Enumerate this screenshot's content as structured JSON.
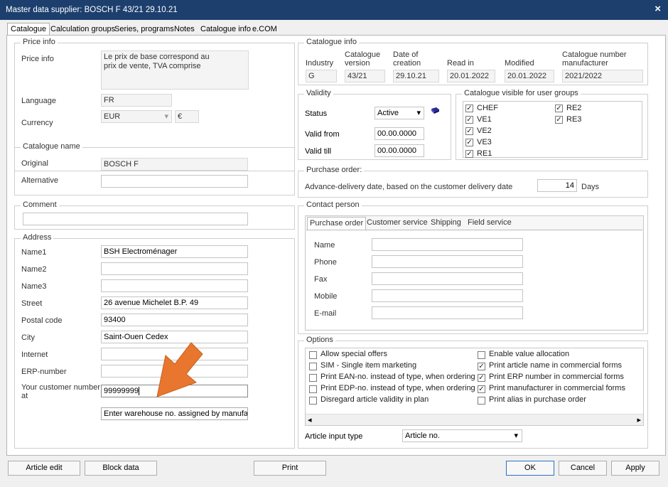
{
  "window": {
    "title": "Master data supplier: BOSCH F  43/21     29.10.21",
    "close": "×"
  },
  "tabs": [
    "Catalogue",
    "Calculation groups",
    "Series, programs",
    "Notes",
    "Catalogue info",
    "e.COM"
  ],
  "price_info": {
    "group": "Price info",
    "label": "Price info",
    "text_line1": "Le prix de base correspond au",
    "text_line2": "prix de vente, TVA comprise",
    "language_label": "Language",
    "language": "FR",
    "currency_label": "Currency",
    "currency": "EUR",
    "currency_symbol": "€",
    "dropdown_arrow": "▾"
  },
  "catalogue_name": {
    "group": "Catalogue name",
    "original_label": "Original",
    "original": "BOSCH F",
    "alternative_label": "Alternative",
    "alternative": ""
  },
  "comment": {
    "group": "Comment",
    "value": ""
  },
  "address": {
    "group": "Address",
    "name1_label": "Name1",
    "name1": "BSH Electroménager",
    "name2_label": "Name2",
    "name2": "",
    "name3_label": "Name3",
    "name3": "",
    "street_label": "Street",
    "street": "26 avenue Michelet B.P. 49",
    "postal_label": "Postal code",
    "postal": "93400",
    "city_label": "City",
    "city": "Saint-Ouen Cedex",
    "internet_label": "Internet",
    "internet": "",
    "erp_label": "ERP-number",
    "erp": "",
    "customer_label_line1": "Your customer number",
    "customer_label_line2": "at",
    "customer_number": "99999999",
    "warehouse": "Enter warehouse no. assigned by manufacturer"
  },
  "catalogue_info": {
    "group": "Catalogue info",
    "industry_label": "Industry",
    "industry": "G",
    "version_label1": "Catalogue",
    "version_label2": "version",
    "version": "43/21",
    "date_label1": "Date of",
    "date_label2": "creation",
    "date": "29.10.21",
    "read_label": "Read in",
    "read": "20.01.2022",
    "modified_label": "Modified",
    "modified": "20.01.2022",
    "mfr_label1": "Catalogue number",
    "mfr_label2": "manufacturer",
    "mfr": "2021/2022"
  },
  "validity": {
    "group": "Validity",
    "status_label": "Status",
    "status": "Active",
    "from_label": "Valid from",
    "from": "00.00.0000",
    "till_label": "Valid till",
    "till": "00.00.0000",
    "dropdown_arrow": "▾"
  },
  "user_groups": {
    "group": "Catalogue visible for user groups",
    "check": "✓",
    "items": [
      {
        "label": "CHEF"
      },
      {
        "label": "VE1"
      },
      {
        "label": "VE2"
      },
      {
        "label": "VE3"
      },
      {
        "label": "RE1"
      },
      {
        "label": "RE2"
      },
      {
        "label": "RE3"
      }
    ]
  },
  "purchase_order": {
    "group": "Purchase order:",
    "advance_label": "Advance-delivery date, based on the customer delivery date",
    "days": "14",
    "days_label": "Days"
  },
  "contact": {
    "group": "Contact person",
    "tabs": [
      "Purchase order",
      "Customer service",
      "Shipping",
      "Field service"
    ],
    "name_label": "Name",
    "phone_label": "Phone",
    "fax_label": "Fax",
    "mobile_label": "Mobile",
    "email_label": "E-mail"
  },
  "options": {
    "group": "Options",
    "check": "✓",
    "left": [
      {
        "label": "Allow special offers",
        "checked": false
      },
      {
        "label": "SIM - Single item marketing",
        "checked": false
      },
      {
        "label": "Print EAN-no. instead of type, when ordering",
        "checked": false
      },
      {
        "label": "Print EDP-no. instead of type, when ordering",
        "checked": false
      },
      {
        "label": "Disregard article validity in plan",
        "checked": false
      }
    ],
    "right": [
      {
        "label": "Enable value allocation",
        "checked": false
      },
      {
        "label": "Print article name in commercial forms",
        "checked": true
      },
      {
        "label": "Print ERP number in commercial forms",
        "checked": true
      },
      {
        "label": "Print manufacturer in commercial forms",
        "checked": true
      },
      {
        "label": "Print alias in purchase order",
        "checked": false
      }
    ],
    "scroll_left": "◂",
    "scroll_right": "▸",
    "article_input_label": "Article input type",
    "article_input": "Article no.",
    "dropdown_arrow": "▾"
  },
  "buttons": {
    "article_edit": "Article edit",
    "block_data": "Block data",
    "print": "Print",
    "ok": "OK",
    "cancel": "Cancel",
    "apply": "Apply"
  },
  "colors": {
    "titlebar": "#1c3f6e",
    "annotation_arrow": "#e8762e",
    "default_button_border": "#2c70c9"
  },
  "edit_icon": "book-pen-icon"
}
